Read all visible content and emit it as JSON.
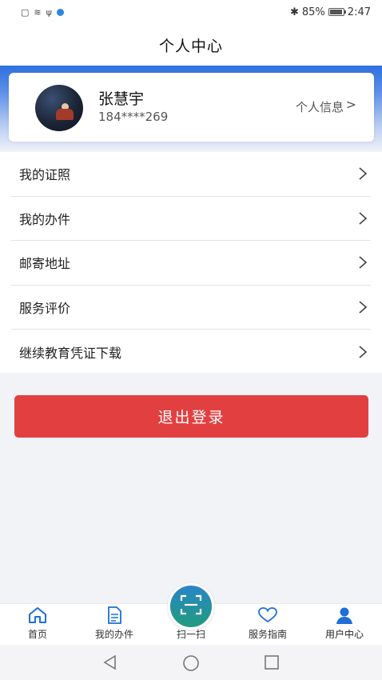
{
  "status_bar": {
    "battery": "85%",
    "time": "2:47",
    "battery_level": 0.85
  },
  "header": {
    "title": "个人中心"
  },
  "profile": {
    "name": "张慧宇",
    "phone": "184****269",
    "info_link": "个人信息",
    "info_chevron": ">"
  },
  "menu": {
    "items": [
      {
        "label": "我的证照"
      },
      {
        "label": "我的办件"
      },
      {
        "label": "邮寄地址"
      },
      {
        "label": "服务评价"
      },
      {
        "label": "继续教育凭证下载"
      }
    ]
  },
  "logout": {
    "label": "退出登录"
  },
  "tabbar": {
    "home": "首页",
    "my_items": "我的办件",
    "scan": "扫一扫",
    "guide": "服务指南",
    "user_center": "用户中心",
    "active": "用户中心"
  },
  "colors": {
    "accent_blue": "#2f6fe0",
    "logout_red": "#e24040",
    "tab_icon_blue": "#1f6fd6"
  }
}
